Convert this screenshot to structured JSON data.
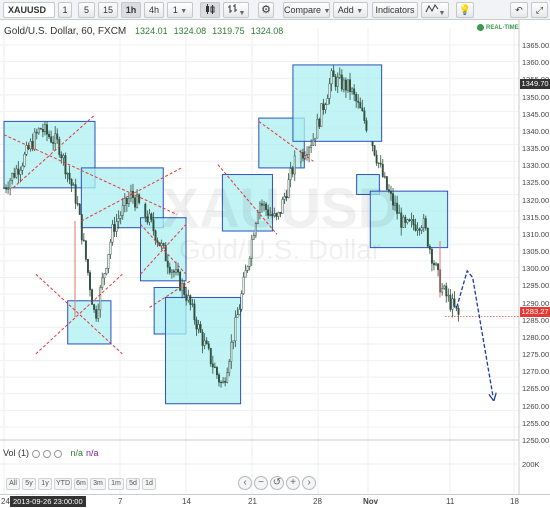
{
  "toolbar": {
    "symbol": "XAUUSD",
    "intervals": [
      "1",
      "5",
      "15",
      "1h",
      "4h",
      "1"
    ],
    "active_interval": "1h",
    "compare_label": "Compare",
    "add_label": "Add",
    "indicators_label": "Indicators"
  },
  "legend": {
    "title": "Gold/U.S. Dollar, 60, FXCM",
    "open": "1324.01",
    "high": "1324.08",
    "low": "1319.75",
    "close": "1324.08"
  },
  "realtime_label": "REAL-TIME",
  "watermark": {
    "symbol": "XAUUSD",
    "name": "Gold/U.S. Dollar"
  },
  "price_axis": {
    "ticks": [
      "1365.00",
      "1360.00",
      "1355.00",
      "1350.00",
      "1345.00",
      "1340.00",
      "1335.00",
      "1330.00",
      "1325.00",
      "1320.00",
      "1315.00",
      "1310.00",
      "1305.00",
      "1300.00",
      "1295.00",
      "1290.00",
      "1285.00",
      "1280.00",
      "1275.00",
      "1270.00",
      "1265.00",
      "1260.00",
      "1255.00",
      "1250.00"
    ],
    "top_price_tag": "1349.70",
    "last_price_tag": "1283.27"
  },
  "volume": {
    "label": "Vol (1)",
    "value1": "n/a",
    "value2": "n/a",
    "tick": "200K"
  },
  "range_buttons": [
    "All",
    "5y",
    "1y",
    "YTD",
    "6m",
    "3m",
    "1m",
    "5d",
    "1d"
  ],
  "time_axis": {
    "cursor_date": "2013-09-26 23:00:00",
    "labels": [
      "24",
      "7",
      "14",
      "21",
      "28",
      "Nov",
      "11",
      "18"
    ]
  },
  "colors": {
    "box_fill": "#aeeff2",
    "box_stroke": "#2a52be",
    "cross": "#e53935",
    "last_price": "#e53935",
    "forecast": "#1a3aa8",
    "candle": "#2f4f3f"
  },
  "chart_data": {
    "type": "line",
    "title": "Gold/U.S. Dollar, 60, FXCM",
    "xlabel": "",
    "ylabel": "",
    "ylim": [
      1250,
      1365
    ],
    "x_labels": [
      "24",
      "7",
      "14",
      "21",
      "28",
      "Nov",
      "11",
      "18"
    ],
    "series": [
      {
        "name": "XAUUSD",
        "x": [
          0,
          4,
          8,
          12,
          16,
          20,
          24,
          28,
          32,
          36,
          40,
          44,
          48,
          52,
          56,
          60,
          64,
          68,
          72,
          76,
          80,
          84,
          88,
          92,
          96,
          100
        ],
        "values": [
          1322,
          1330,
          1340,
          1335,
          1318,
          1283,
          1310,
          1320,
          1312,
          1300,
          1290,
          1275,
          1262,
          1288,
          1318,
          1312,
          1330,
          1337,
          1355,
          1352,
          1340,
          1322,
          1310,
          1312,
          1292,
          1283.27
        ]
      }
    ],
    "last_price": 1283.27
  }
}
